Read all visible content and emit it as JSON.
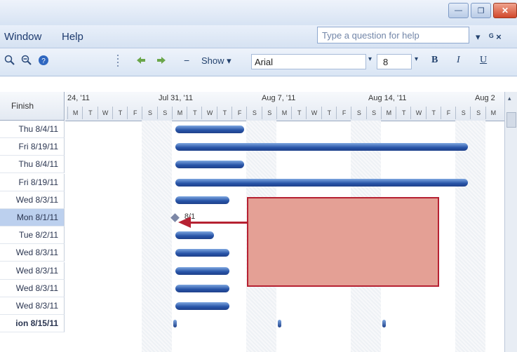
{
  "window": {
    "minimize_label": "—",
    "restore_label": "❐",
    "close_label": "✕"
  },
  "menubar": {
    "items": [
      "Window",
      "Help"
    ],
    "help_placeholder": "Type a question for help",
    "help_dropdown": "▾",
    "doc_controls": "ᴳ ×"
  },
  "toolbar": {
    "show_label": "Show ▾",
    "font_name": "Arial",
    "font_size": "8",
    "bold": "B",
    "italic": "I",
    "underline": "U",
    "minus": "−"
  },
  "grid": {
    "column_header": "Finish",
    "rows": [
      {
        "finish": "Thu 8/4/11",
        "selected": false,
        "bold": false
      },
      {
        "finish": "Fri 8/19/11",
        "selected": false,
        "bold": false
      },
      {
        "finish": "Thu 8/4/11",
        "selected": false,
        "bold": false
      },
      {
        "finish": "Fri 8/19/11",
        "selected": false,
        "bold": false
      },
      {
        "finish": "Wed 8/3/11",
        "selected": false,
        "bold": false
      },
      {
        "finish": "Mon 8/1/11",
        "selected": true,
        "bold": false
      },
      {
        "finish": "Tue 8/2/11",
        "selected": false,
        "bold": false
      },
      {
        "finish": "Wed 8/3/11",
        "selected": false,
        "bold": false
      },
      {
        "finish": "Wed 8/3/11",
        "selected": false,
        "bold": false
      },
      {
        "finish": "Wed 8/3/11",
        "selected": false,
        "bold": false
      },
      {
        "finish": "Wed 8/3/11",
        "selected": false,
        "bold": false
      },
      {
        "finish": "ion 8/15/11",
        "selected": false,
        "bold": true
      }
    ]
  },
  "timescale": {
    "weeks": [
      "24, '11",
      "Jul 31, '11",
      "Aug 7, '11",
      "Aug 14, '11",
      "Aug 2"
    ],
    "days": [
      "M",
      "T",
      "W",
      "T",
      "F",
      "S",
      "S",
      "M",
      "T",
      "W",
      "T",
      "F",
      "S",
      "S",
      "M",
      "T",
      "W",
      "T",
      "F",
      "S",
      "S",
      "M",
      "T",
      "W",
      "T",
      "F",
      "S",
      "S",
      "M"
    ]
  },
  "milestone_label": "8/1",
  "colors": {
    "bar": "#2753a7",
    "callout_fill": "#e4a095",
    "callout_border": "#b62132",
    "selected_row": "#bcd0ee"
  }
}
